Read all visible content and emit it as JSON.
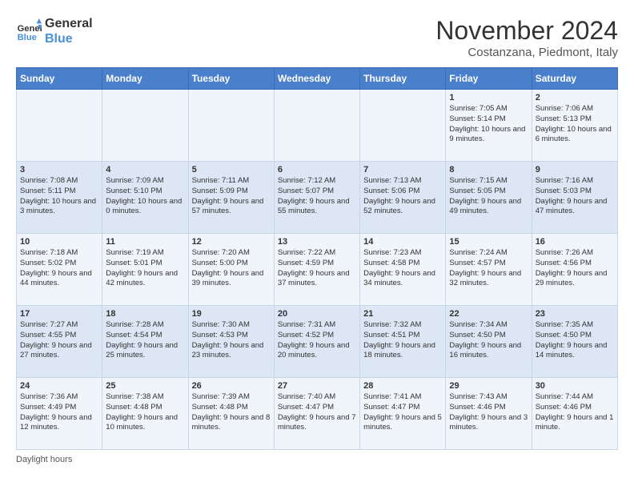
{
  "logo": {
    "line1": "General",
    "line2": "Blue"
  },
  "title": "November 2024",
  "subtitle": "Costanzana, Piedmont, Italy",
  "days_of_week": [
    "Sunday",
    "Monday",
    "Tuesday",
    "Wednesday",
    "Thursday",
    "Friday",
    "Saturday"
  ],
  "weeks": [
    [
      {
        "day": "",
        "info": ""
      },
      {
        "day": "",
        "info": ""
      },
      {
        "day": "",
        "info": ""
      },
      {
        "day": "",
        "info": ""
      },
      {
        "day": "",
        "info": ""
      },
      {
        "day": "1",
        "info": "Sunrise: 7:05 AM\nSunset: 5:14 PM\nDaylight: 10 hours and 9 minutes."
      },
      {
        "day": "2",
        "info": "Sunrise: 7:06 AM\nSunset: 5:13 PM\nDaylight: 10 hours and 6 minutes."
      }
    ],
    [
      {
        "day": "3",
        "info": "Sunrise: 7:08 AM\nSunset: 5:11 PM\nDaylight: 10 hours and 3 minutes."
      },
      {
        "day": "4",
        "info": "Sunrise: 7:09 AM\nSunset: 5:10 PM\nDaylight: 10 hours and 0 minutes."
      },
      {
        "day": "5",
        "info": "Sunrise: 7:11 AM\nSunset: 5:09 PM\nDaylight: 9 hours and 57 minutes."
      },
      {
        "day": "6",
        "info": "Sunrise: 7:12 AM\nSunset: 5:07 PM\nDaylight: 9 hours and 55 minutes."
      },
      {
        "day": "7",
        "info": "Sunrise: 7:13 AM\nSunset: 5:06 PM\nDaylight: 9 hours and 52 minutes."
      },
      {
        "day": "8",
        "info": "Sunrise: 7:15 AM\nSunset: 5:05 PM\nDaylight: 9 hours and 49 minutes."
      },
      {
        "day": "9",
        "info": "Sunrise: 7:16 AM\nSunset: 5:03 PM\nDaylight: 9 hours and 47 minutes."
      }
    ],
    [
      {
        "day": "10",
        "info": "Sunrise: 7:18 AM\nSunset: 5:02 PM\nDaylight: 9 hours and 44 minutes."
      },
      {
        "day": "11",
        "info": "Sunrise: 7:19 AM\nSunset: 5:01 PM\nDaylight: 9 hours and 42 minutes."
      },
      {
        "day": "12",
        "info": "Sunrise: 7:20 AM\nSunset: 5:00 PM\nDaylight: 9 hours and 39 minutes."
      },
      {
        "day": "13",
        "info": "Sunrise: 7:22 AM\nSunset: 4:59 PM\nDaylight: 9 hours and 37 minutes."
      },
      {
        "day": "14",
        "info": "Sunrise: 7:23 AM\nSunset: 4:58 PM\nDaylight: 9 hours and 34 minutes."
      },
      {
        "day": "15",
        "info": "Sunrise: 7:24 AM\nSunset: 4:57 PM\nDaylight: 9 hours and 32 minutes."
      },
      {
        "day": "16",
        "info": "Sunrise: 7:26 AM\nSunset: 4:56 PM\nDaylight: 9 hours and 29 minutes."
      }
    ],
    [
      {
        "day": "17",
        "info": "Sunrise: 7:27 AM\nSunset: 4:55 PM\nDaylight: 9 hours and 27 minutes."
      },
      {
        "day": "18",
        "info": "Sunrise: 7:28 AM\nSunset: 4:54 PM\nDaylight: 9 hours and 25 minutes."
      },
      {
        "day": "19",
        "info": "Sunrise: 7:30 AM\nSunset: 4:53 PM\nDaylight: 9 hours and 23 minutes."
      },
      {
        "day": "20",
        "info": "Sunrise: 7:31 AM\nSunset: 4:52 PM\nDaylight: 9 hours and 20 minutes."
      },
      {
        "day": "21",
        "info": "Sunrise: 7:32 AM\nSunset: 4:51 PM\nDaylight: 9 hours and 18 minutes."
      },
      {
        "day": "22",
        "info": "Sunrise: 7:34 AM\nSunset: 4:50 PM\nDaylight: 9 hours and 16 minutes."
      },
      {
        "day": "23",
        "info": "Sunrise: 7:35 AM\nSunset: 4:50 PM\nDaylight: 9 hours and 14 minutes."
      }
    ],
    [
      {
        "day": "24",
        "info": "Sunrise: 7:36 AM\nSunset: 4:49 PM\nDaylight: 9 hours and 12 minutes."
      },
      {
        "day": "25",
        "info": "Sunrise: 7:38 AM\nSunset: 4:48 PM\nDaylight: 9 hours and 10 minutes."
      },
      {
        "day": "26",
        "info": "Sunrise: 7:39 AM\nSunset: 4:48 PM\nDaylight: 9 hours and 8 minutes."
      },
      {
        "day": "27",
        "info": "Sunrise: 7:40 AM\nSunset: 4:47 PM\nDaylight: 9 hours and 7 minutes."
      },
      {
        "day": "28",
        "info": "Sunrise: 7:41 AM\nSunset: 4:47 PM\nDaylight: 9 hours and 5 minutes."
      },
      {
        "day": "29",
        "info": "Sunrise: 7:43 AM\nSunset: 4:46 PM\nDaylight: 9 hours and 3 minutes."
      },
      {
        "day": "30",
        "info": "Sunrise: 7:44 AM\nSunset: 4:46 PM\nDaylight: 9 hours and 1 minute."
      }
    ]
  ],
  "footer": "Daylight hours"
}
